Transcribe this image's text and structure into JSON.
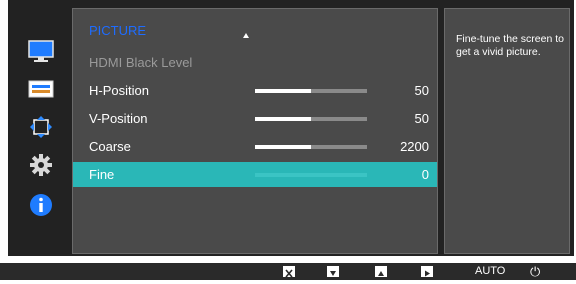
{
  "sidebar": {
    "icons": [
      {
        "name": "picture-icon",
        "active": true
      },
      {
        "name": "onscreen-display-icon",
        "active": false
      },
      {
        "name": "size-position-icon",
        "active": false
      },
      {
        "name": "setup-icon",
        "active": false
      },
      {
        "name": "information-icon",
        "active": false
      }
    ]
  },
  "menu": {
    "title": "PICTURE",
    "items": [
      {
        "label": "HDMI Black Level",
        "value": "",
        "disabled": true,
        "fill": null,
        "selected": false
      },
      {
        "label": "H-Position",
        "value": "50",
        "disabled": false,
        "fill": 0.5,
        "selected": false
      },
      {
        "label": "V-Position",
        "value": "50",
        "disabled": false,
        "fill": 0.5,
        "selected": false
      },
      {
        "label": "Coarse",
        "value": "2200",
        "disabled": false,
        "fill": 0.5,
        "selected": false
      },
      {
        "label": "Fine",
        "value": "0",
        "disabled": false,
        "fill": 0.0,
        "selected": true
      }
    ]
  },
  "info": {
    "text": "Fine-tune the screen to get a vivid picture."
  },
  "bottom": {
    "buttons": [
      "close",
      "down",
      "up",
      "enter"
    ],
    "auto_label": "AUTO",
    "power_label": "⏻"
  },
  "colors": {
    "accent": "#2ab7b7",
    "title": "#1e6cff",
    "panel": "#4a4a4a",
    "background": "#222222"
  }
}
